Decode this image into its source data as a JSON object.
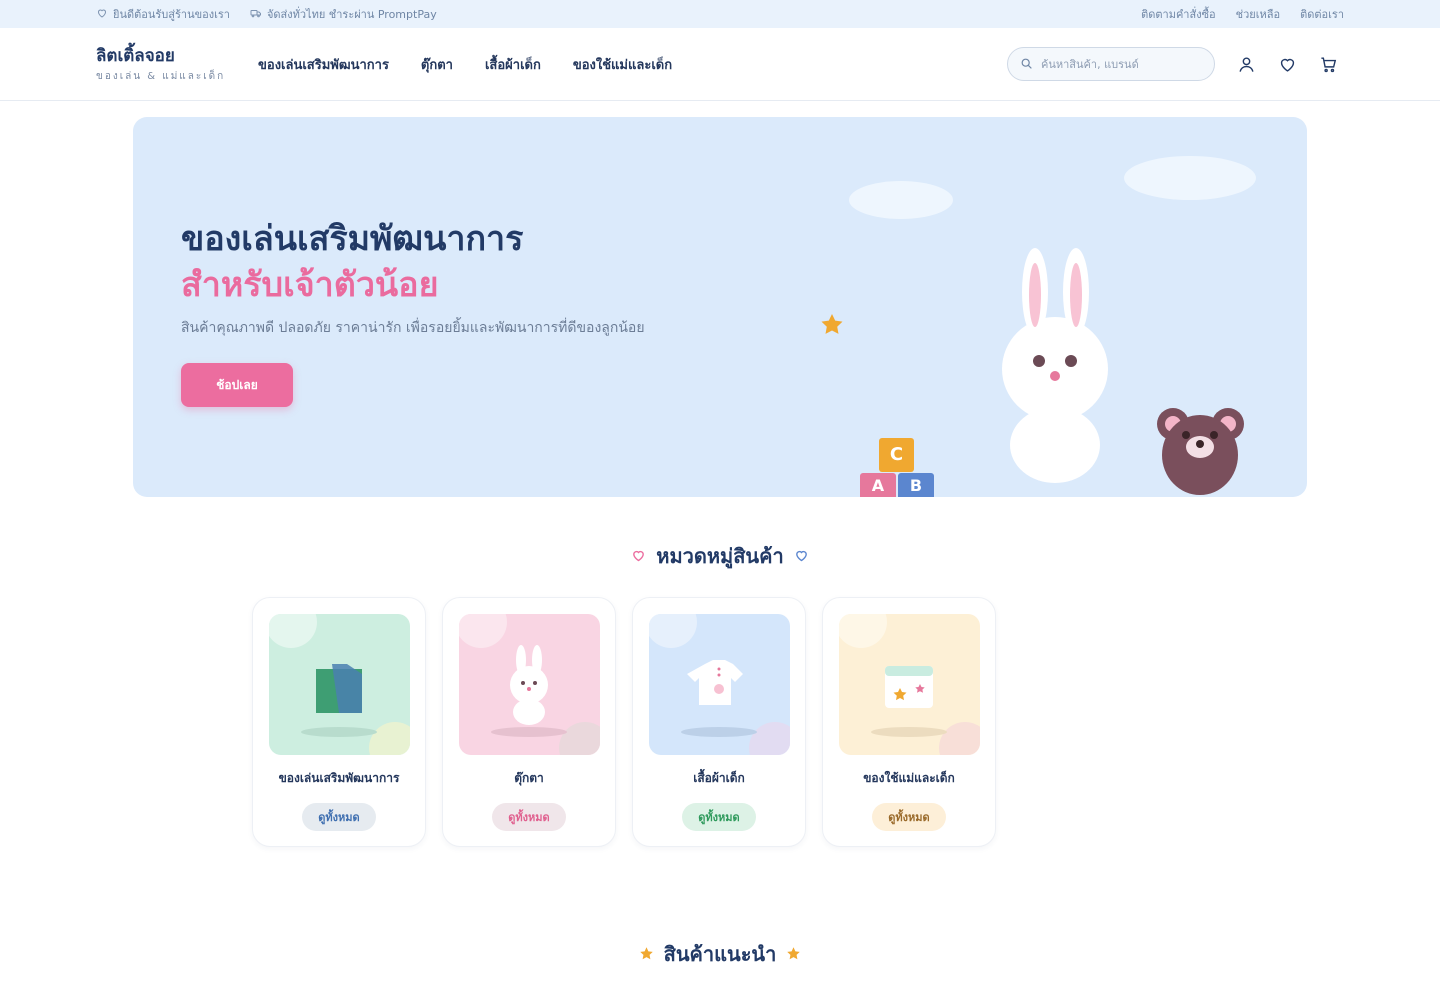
{
  "topbar": {
    "welcome": "ยินดีต้อนรับสู่ร้านของเรา",
    "shipping": "จัดส่งทั่วไทย ชำระผ่าน PromptPay",
    "links": [
      "ติดตามคำสั่งซื้อ",
      "ช่วยเหลือ",
      "ติดต่อเรา"
    ]
  },
  "brand": {
    "name": "ลิตเติ้ลจอย",
    "tagline": "ของเล่น & แม่และเด็ก"
  },
  "nav": [
    "ของเล่นเสริมพัฒนาการ",
    "ตุ๊กตา",
    "เสื้อผ้าเด็ก",
    "ของใช้แม่และเด็ก"
  ],
  "search": {
    "placeholder": "ค้นหาสินค้า, แบรนด์",
    "value": ""
  },
  "header_icons": [
    "user-icon",
    "heart-icon",
    "cart-icon"
  ],
  "hero": {
    "title_line1": "ของเล่นเสริมพัฒนาการ",
    "title_line2": "สำหรับเจ้าตัวน้อย",
    "subtitle": "สินค้าคุณภาพดี ปลอดภัย ราคาน่ารัก เพื่อรอยยิ้มและพัฒนาการที่ดีของลูกน้อย",
    "cta": "ช้อปเลย",
    "block_letters": [
      "C",
      "A",
      "B"
    ]
  },
  "categories_section": {
    "title": "หมวดหมู่สินค้า"
  },
  "categories": [
    {
      "name": "ของเล่นเสริมพัฒนาการ",
      "action": "ดูทั้งหมด",
      "bg": "#cdeee0",
      "pill_bg": "#e6ebf0",
      "pill_color": "#3f6fb0"
    },
    {
      "name": "ตุ๊กตา",
      "action": "ดูทั้งหมด",
      "bg": "#f9d5e3",
      "pill_bg": "#f0e6ea",
      "pill_color": "#e0608f"
    },
    {
      "name": "เสื้อผ้าเด็ก",
      "action": "ดูทั้งหมด",
      "bg": "#d4e6fb",
      "pill_bg": "#ddf2e6",
      "pill_color": "#2f9a5c"
    },
    {
      "name": "ของใช้แม่และเด็ก",
      "action": "ดูทั้งหมด",
      "bg": "#fdf0d6",
      "pill_bg": "#fdefd8",
      "pill_color": "#9a6a2a"
    }
  ],
  "featured_section": {
    "title": "สินค้าแนะนำ"
  },
  "colors": {
    "navy": "#223a66",
    "pink": "#ec6d9f",
    "hero_bg": "#dbeafb",
    "star": "#f0a830"
  }
}
